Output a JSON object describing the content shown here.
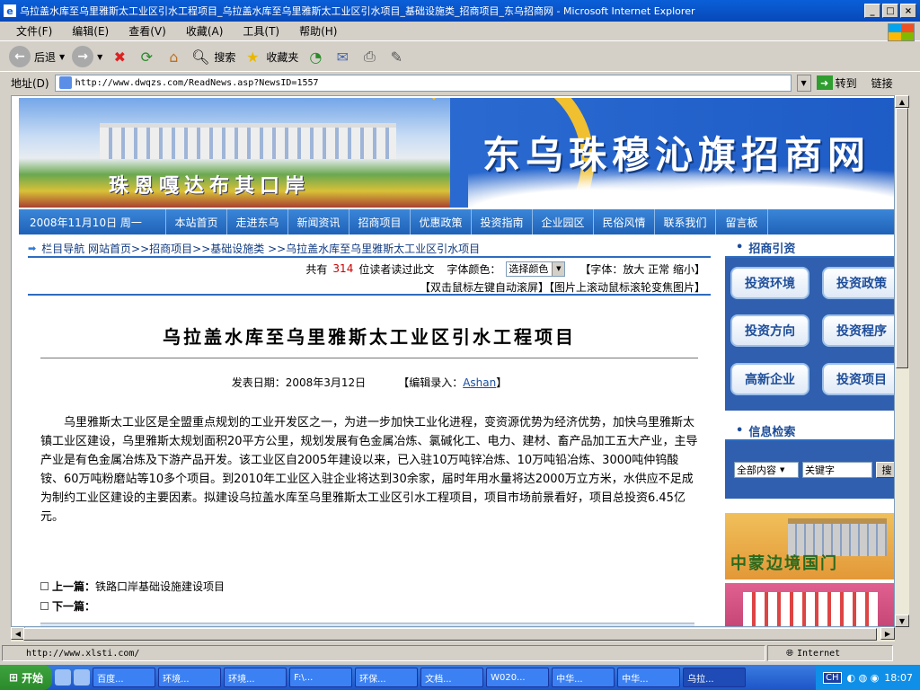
{
  "window": {
    "title": "乌拉盖水库至乌里雅斯太工业区引水工程项目_乌拉盖水库至乌里雅斯太工业区引水项目_基础设施类_招商项目_东乌招商网 - Microsoft Internet Explorer",
    "controls": {
      "minimize": "_",
      "maximize": "□",
      "close": "×"
    }
  },
  "menu": [
    "文件(F)",
    "编辑(E)",
    "查看(V)",
    "收藏(A)",
    "工具(T)",
    "帮助(H)"
  ],
  "toolbar": {
    "back": "后退",
    "search": "搜索",
    "favorites": "收藏夹"
  },
  "address": {
    "label": "地址(D)",
    "url": "http://www.dwqzs.com/ReadNews.asp?NewsID=1557",
    "go": "转到",
    "links": "链接"
  },
  "site": {
    "name": "东乌珠穆沁旗招商网",
    "motto": "珠恩嘎达布其口岸",
    "nav": {
      "date": "2008年11月10日 周一",
      "items": [
        "本站首页",
        "走进东乌",
        "新闻资讯",
        "招商项目",
        "优惠政策",
        "投资指南",
        "企业园区",
        "民俗风情",
        "联系我们",
        "留言板"
      ]
    }
  },
  "breadcrumb": "栏目导航 网站首页>>招商项目>>基础设施类 >>乌拉盖水库至乌里雅斯太工业区引水项目",
  "read": {
    "prefix": "共有",
    "count": "314",
    "suffix": "位读者读过此文",
    "color_label": "字体颜色：",
    "color_select": "选择颜色",
    "font_size": "【字体：放大 正常 缩小】",
    "hint": "【双击鼠标左键自动滚屏】【图片上滚动鼠标滚轮变焦图片】"
  },
  "article": {
    "title": "乌拉盖水库至乌里雅斯太工业区引水工程项目",
    "date": "发表日期：2008年3月12日",
    "editor_prefix": "【编辑录入：",
    "editor": "Ashan",
    "editor_suffix": "】",
    "body": "乌里雅斯太工业区是全盟重点规划的工业开发区之一，为进一步加快工业化进程，变资源优势为经济优势，加快乌里雅斯太镇工业区建设，乌里雅斯太规划面积20平方公里，规划发展有色金属冶炼、氯碱化工、电力、建材、畜产品加工五大产业，主导产业是有色金属冶炼及下游产品开发。该工业区自2005年建设以来，已入驻10万吨锌冶炼、10万吨铅冶炼、3000吨仲钨酸铵、60万吨粉磨站等10多个项目。到2010年工业区入驻企业将达到30余家，届时年用水量将达2000万立方米，水供应不足成为制约工业区建设的主要因素。拟建设乌拉盖水库至乌里雅斯太工业区引水工程项目，项目市场前景看好，项目总投资6.45亿元。",
    "prev_label": "上一篇：",
    "prev": "铁路口岸基础设施建设项目",
    "next_label": "下一篇："
  },
  "sidebar": {
    "invest_title": "招商引资",
    "buttons": [
      "投资环境",
      "投资政策",
      "投资方向",
      "投资程序",
      "高新企业",
      "投资项目"
    ],
    "search_title": "信息检索",
    "search_scope": "全部内容",
    "search_placeholder": "关键字",
    "search_btn": "搜",
    "ad1": "中蒙边境国门"
  },
  "status": {
    "url": "http://www.xlsti.com/",
    "zone": "Internet"
  },
  "taskbar": {
    "start": "开始",
    "tasks": [
      "百度...",
      "环境...",
      "环境...",
      "F:\\...",
      "环保...",
      "文档...",
      "W020...",
      "中华...",
      "中华...",
      "乌拉..."
    ],
    "lang": "CH",
    "clock": "18:07"
  }
}
